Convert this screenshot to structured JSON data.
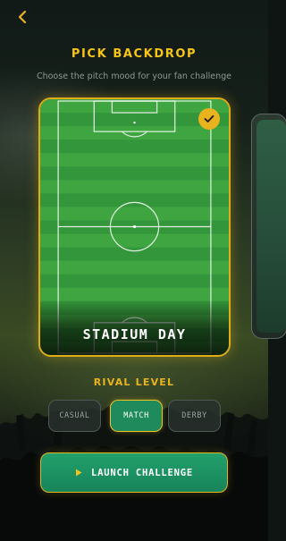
{
  "header": {
    "back_icon": "chevron-left-icon",
    "title": "PICK BACKDROP",
    "subtitle": "Choose the pitch mood for your fan challenge"
  },
  "backdrop": {
    "selected_label": "STADIUM DAY",
    "selected_icon": "check-icon",
    "next_preview": ""
  },
  "rival": {
    "title": "RIVAL LEVEL",
    "levels": [
      "CASUAL",
      "MATCH",
      "DERBY"
    ],
    "selected": "MATCH"
  },
  "cta": {
    "icon": "play-icon",
    "label": "LAUNCH CHALLENGE"
  },
  "colors": {
    "accent_gold": "#f5c518",
    "accent_green": "#1f8a5b",
    "pitch_light": "#3fa541",
    "pitch_dark": "#34963a"
  }
}
